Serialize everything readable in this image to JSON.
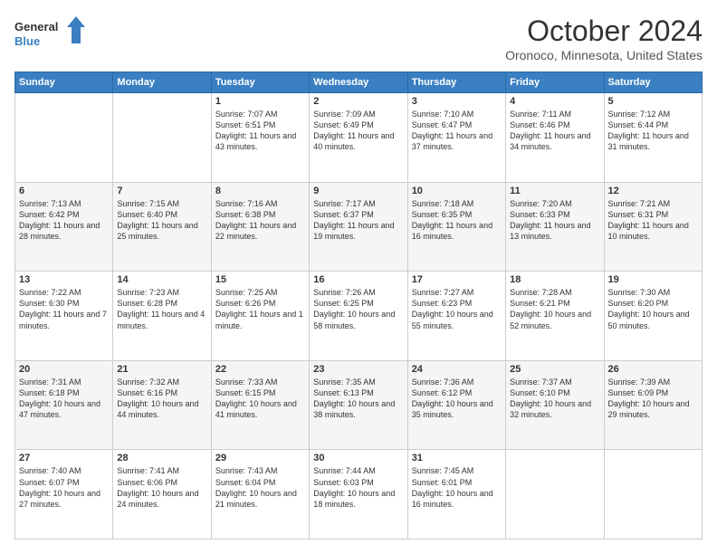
{
  "header": {
    "logo_line1": "General",
    "logo_line2": "Blue",
    "month": "October 2024",
    "location": "Oronoco, Minnesota, United States"
  },
  "days_of_week": [
    "Sunday",
    "Monday",
    "Tuesday",
    "Wednesday",
    "Thursday",
    "Friday",
    "Saturday"
  ],
  "weeks": [
    [
      {
        "day": "",
        "info": ""
      },
      {
        "day": "",
        "info": ""
      },
      {
        "day": "1",
        "info": "Sunrise: 7:07 AM\nSunset: 6:51 PM\nDaylight: 11 hours and 43 minutes."
      },
      {
        "day": "2",
        "info": "Sunrise: 7:09 AM\nSunset: 6:49 PM\nDaylight: 11 hours and 40 minutes."
      },
      {
        "day": "3",
        "info": "Sunrise: 7:10 AM\nSunset: 6:47 PM\nDaylight: 11 hours and 37 minutes."
      },
      {
        "day": "4",
        "info": "Sunrise: 7:11 AM\nSunset: 6:46 PM\nDaylight: 11 hours and 34 minutes."
      },
      {
        "day": "5",
        "info": "Sunrise: 7:12 AM\nSunset: 6:44 PM\nDaylight: 11 hours and 31 minutes."
      }
    ],
    [
      {
        "day": "6",
        "info": "Sunrise: 7:13 AM\nSunset: 6:42 PM\nDaylight: 11 hours and 28 minutes."
      },
      {
        "day": "7",
        "info": "Sunrise: 7:15 AM\nSunset: 6:40 PM\nDaylight: 11 hours and 25 minutes."
      },
      {
        "day": "8",
        "info": "Sunrise: 7:16 AM\nSunset: 6:38 PM\nDaylight: 11 hours and 22 minutes."
      },
      {
        "day": "9",
        "info": "Sunrise: 7:17 AM\nSunset: 6:37 PM\nDaylight: 11 hours and 19 minutes."
      },
      {
        "day": "10",
        "info": "Sunrise: 7:18 AM\nSunset: 6:35 PM\nDaylight: 11 hours and 16 minutes."
      },
      {
        "day": "11",
        "info": "Sunrise: 7:20 AM\nSunset: 6:33 PM\nDaylight: 11 hours and 13 minutes."
      },
      {
        "day": "12",
        "info": "Sunrise: 7:21 AM\nSunset: 6:31 PM\nDaylight: 11 hours and 10 minutes."
      }
    ],
    [
      {
        "day": "13",
        "info": "Sunrise: 7:22 AM\nSunset: 6:30 PM\nDaylight: 11 hours and 7 minutes."
      },
      {
        "day": "14",
        "info": "Sunrise: 7:23 AM\nSunset: 6:28 PM\nDaylight: 11 hours and 4 minutes."
      },
      {
        "day": "15",
        "info": "Sunrise: 7:25 AM\nSunset: 6:26 PM\nDaylight: 11 hours and 1 minute."
      },
      {
        "day": "16",
        "info": "Sunrise: 7:26 AM\nSunset: 6:25 PM\nDaylight: 10 hours and 58 minutes."
      },
      {
        "day": "17",
        "info": "Sunrise: 7:27 AM\nSunset: 6:23 PM\nDaylight: 10 hours and 55 minutes."
      },
      {
        "day": "18",
        "info": "Sunrise: 7:28 AM\nSunset: 6:21 PM\nDaylight: 10 hours and 52 minutes."
      },
      {
        "day": "19",
        "info": "Sunrise: 7:30 AM\nSunset: 6:20 PM\nDaylight: 10 hours and 50 minutes."
      }
    ],
    [
      {
        "day": "20",
        "info": "Sunrise: 7:31 AM\nSunset: 6:18 PM\nDaylight: 10 hours and 47 minutes."
      },
      {
        "day": "21",
        "info": "Sunrise: 7:32 AM\nSunset: 6:16 PM\nDaylight: 10 hours and 44 minutes."
      },
      {
        "day": "22",
        "info": "Sunrise: 7:33 AM\nSunset: 6:15 PM\nDaylight: 10 hours and 41 minutes."
      },
      {
        "day": "23",
        "info": "Sunrise: 7:35 AM\nSunset: 6:13 PM\nDaylight: 10 hours and 38 minutes."
      },
      {
        "day": "24",
        "info": "Sunrise: 7:36 AM\nSunset: 6:12 PM\nDaylight: 10 hours and 35 minutes."
      },
      {
        "day": "25",
        "info": "Sunrise: 7:37 AM\nSunset: 6:10 PM\nDaylight: 10 hours and 32 minutes."
      },
      {
        "day": "26",
        "info": "Sunrise: 7:39 AM\nSunset: 6:09 PM\nDaylight: 10 hours and 29 minutes."
      }
    ],
    [
      {
        "day": "27",
        "info": "Sunrise: 7:40 AM\nSunset: 6:07 PM\nDaylight: 10 hours and 27 minutes."
      },
      {
        "day": "28",
        "info": "Sunrise: 7:41 AM\nSunset: 6:06 PM\nDaylight: 10 hours and 24 minutes."
      },
      {
        "day": "29",
        "info": "Sunrise: 7:43 AM\nSunset: 6:04 PM\nDaylight: 10 hours and 21 minutes."
      },
      {
        "day": "30",
        "info": "Sunrise: 7:44 AM\nSunset: 6:03 PM\nDaylight: 10 hours and 18 minutes."
      },
      {
        "day": "31",
        "info": "Sunrise: 7:45 AM\nSunset: 6:01 PM\nDaylight: 10 hours and 16 minutes."
      },
      {
        "day": "",
        "info": ""
      },
      {
        "day": "",
        "info": ""
      }
    ]
  ]
}
